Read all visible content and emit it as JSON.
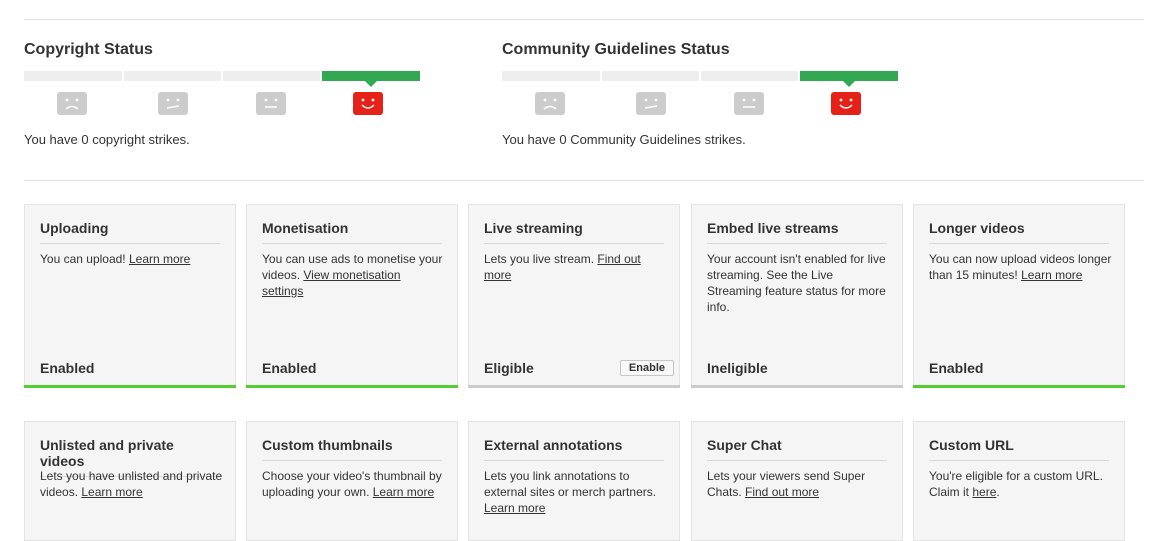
{
  "copyright": {
    "title": "Copyright Status",
    "strikes_text": "You have 0 copyright strikes.",
    "active_level": 4,
    "levels": 4
  },
  "community": {
    "title": "Community Guidelines Status",
    "strikes_text": "You have 0 Community Guidelines strikes.",
    "active_level": 4,
    "levels": 4
  },
  "colors": {
    "active_bar": "#33a853",
    "active_face": "#e62117",
    "inactive_face": "#cccccc",
    "enabled_underline": "#55cc33"
  },
  "icons": [
    "sad-face-icon",
    "neutral-face-icon",
    "smile-face-icon"
  ],
  "features": [
    {
      "title": "Uploading",
      "desc": "You can upload! ",
      "link": "Learn more",
      "state": "Enabled"
    },
    {
      "title": "Monetisation",
      "desc": "You can use ads to monetise your videos. ",
      "link": "View monetisation settings",
      "state": "Enabled"
    },
    {
      "title": "Live streaming",
      "desc": "Lets you live stream. ",
      "link": "Find out more",
      "state": "Eligible",
      "button": "Enable"
    },
    {
      "title": "Embed live streams",
      "desc": "Your account isn't enabled for live streaming. See the Live Streaming feature status for more info.",
      "state": "Ineligible"
    },
    {
      "title": "Longer videos",
      "desc": "You can now upload videos longer than 15 minutes! ",
      "link": "Learn more",
      "state": "Enabled"
    },
    {
      "title": "Unlisted and private videos",
      "desc": "Lets you have unlisted and private videos. ",
      "link": "Learn more"
    },
    {
      "title": "Custom thumbnails",
      "desc": "Choose your video's thumbnail by uploading your own. ",
      "link": "Learn more"
    },
    {
      "title": "External annotations",
      "desc": "Lets you link annotations to external sites or merch partners. ",
      "link": "Learn more"
    },
    {
      "title": "Super Chat",
      "desc": "Lets your viewers send Super Chats. ",
      "link": "Find out more"
    },
    {
      "title": "Custom URL",
      "desc": "You're eligible for a custom URL. Claim it ",
      "link": "here",
      "suffix": "."
    }
  ]
}
